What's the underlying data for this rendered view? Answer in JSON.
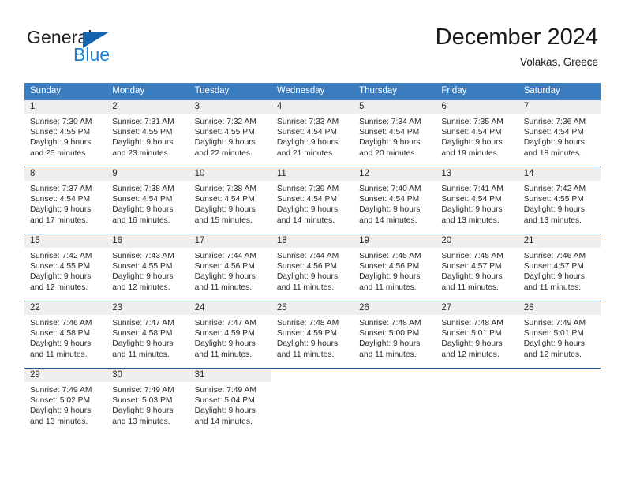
{
  "brand": {
    "name_part1": "General",
    "name_part2": "Blue",
    "triangle_color": "#1565ae",
    "blue_color": "#1b7fd4"
  },
  "header": {
    "title": "December 2024",
    "subtitle": "Volakas, Greece"
  },
  "theme": {
    "header_bg": "#3a7cc0",
    "row_divider": "#1a5fa0",
    "daynum_bg": "#efefef",
    "text": "#2b2b2b"
  },
  "calendar": {
    "weekday_headers": [
      "Sunday",
      "Monday",
      "Tuesday",
      "Wednesday",
      "Thursday",
      "Friday",
      "Saturday"
    ],
    "weeks": [
      [
        {
          "day": "1",
          "sunrise": "Sunrise: 7:30 AM",
          "sunset": "Sunset: 4:55 PM",
          "daylight1": "Daylight: 9 hours",
          "daylight2": "and 25 minutes."
        },
        {
          "day": "2",
          "sunrise": "Sunrise: 7:31 AM",
          "sunset": "Sunset: 4:55 PM",
          "daylight1": "Daylight: 9 hours",
          "daylight2": "and 23 minutes."
        },
        {
          "day": "3",
          "sunrise": "Sunrise: 7:32 AM",
          "sunset": "Sunset: 4:55 PM",
          "daylight1": "Daylight: 9 hours",
          "daylight2": "and 22 minutes."
        },
        {
          "day": "4",
          "sunrise": "Sunrise: 7:33 AM",
          "sunset": "Sunset: 4:54 PM",
          "daylight1": "Daylight: 9 hours",
          "daylight2": "and 21 minutes."
        },
        {
          "day": "5",
          "sunrise": "Sunrise: 7:34 AM",
          "sunset": "Sunset: 4:54 PM",
          "daylight1": "Daylight: 9 hours",
          "daylight2": "and 20 minutes."
        },
        {
          "day": "6",
          "sunrise": "Sunrise: 7:35 AM",
          "sunset": "Sunset: 4:54 PM",
          "daylight1": "Daylight: 9 hours",
          "daylight2": "and 19 minutes."
        },
        {
          "day": "7",
          "sunrise": "Sunrise: 7:36 AM",
          "sunset": "Sunset: 4:54 PM",
          "daylight1": "Daylight: 9 hours",
          "daylight2": "and 18 minutes."
        }
      ],
      [
        {
          "day": "8",
          "sunrise": "Sunrise: 7:37 AM",
          "sunset": "Sunset: 4:54 PM",
          "daylight1": "Daylight: 9 hours",
          "daylight2": "and 17 minutes."
        },
        {
          "day": "9",
          "sunrise": "Sunrise: 7:38 AM",
          "sunset": "Sunset: 4:54 PM",
          "daylight1": "Daylight: 9 hours",
          "daylight2": "and 16 minutes."
        },
        {
          "day": "10",
          "sunrise": "Sunrise: 7:38 AM",
          "sunset": "Sunset: 4:54 PM",
          "daylight1": "Daylight: 9 hours",
          "daylight2": "and 15 minutes."
        },
        {
          "day": "11",
          "sunrise": "Sunrise: 7:39 AM",
          "sunset": "Sunset: 4:54 PM",
          "daylight1": "Daylight: 9 hours",
          "daylight2": "and 14 minutes."
        },
        {
          "day": "12",
          "sunrise": "Sunrise: 7:40 AM",
          "sunset": "Sunset: 4:54 PM",
          "daylight1": "Daylight: 9 hours",
          "daylight2": "and 14 minutes."
        },
        {
          "day": "13",
          "sunrise": "Sunrise: 7:41 AM",
          "sunset": "Sunset: 4:54 PM",
          "daylight1": "Daylight: 9 hours",
          "daylight2": "and 13 minutes."
        },
        {
          "day": "14",
          "sunrise": "Sunrise: 7:42 AM",
          "sunset": "Sunset: 4:55 PM",
          "daylight1": "Daylight: 9 hours",
          "daylight2": "and 13 minutes."
        }
      ],
      [
        {
          "day": "15",
          "sunrise": "Sunrise: 7:42 AM",
          "sunset": "Sunset: 4:55 PM",
          "daylight1": "Daylight: 9 hours",
          "daylight2": "and 12 minutes."
        },
        {
          "day": "16",
          "sunrise": "Sunrise: 7:43 AM",
          "sunset": "Sunset: 4:55 PM",
          "daylight1": "Daylight: 9 hours",
          "daylight2": "and 12 minutes."
        },
        {
          "day": "17",
          "sunrise": "Sunrise: 7:44 AM",
          "sunset": "Sunset: 4:56 PM",
          "daylight1": "Daylight: 9 hours",
          "daylight2": "and 11 minutes."
        },
        {
          "day": "18",
          "sunrise": "Sunrise: 7:44 AM",
          "sunset": "Sunset: 4:56 PM",
          "daylight1": "Daylight: 9 hours",
          "daylight2": "and 11 minutes."
        },
        {
          "day": "19",
          "sunrise": "Sunrise: 7:45 AM",
          "sunset": "Sunset: 4:56 PM",
          "daylight1": "Daylight: 9 hours",
          "daylight2": "and 11 minutes."
        },
        {
          "day": "20",
          "sunrise": "Sunrise: 7:45 AM",
          "sunset": "Sunset: 4:57 PM",
          "daylight1": "Daylight: 9 hours",
          "daylight2": "and 11 minutes."
        },
        {
          "day": "21",
          "sunrise": "Sunrise: 7:46 AM",
          "sunset": "Sunset: 4:57 PM",
          "daylight1": "Daylight: 9 hours",
          "daylight2": "and 11 minutes."
        }
      ],
      [
        {
          "day": "22",
          "sunrise": "Sunrise: 7:46 AM",
          "sunset": "Sunset: 4:58 PM",
          "daylight1": "Daylight: 9 hours",
          "daylight2": "and 11 minutes."
        },
        {
          "day": "23",
          "sunrise": "Sunrise: 7:47 AM",
          "sunset": "Sunset: 4:58 PM",
          "daylight1": "Daylight: 9 hours",
          "daylight2": "and 11 minutes."
        },
        {
          "day": "24",
          "sunrise": "Sunrise: 7:47 AM",
          "sunset": "Sunset: 4:59 PM",
          "daylight1": "Daylight: 9 hours",
          "daylight2": "and 11 minutes."
        },
        {
          "day": "25",
          "sunrise": "Sunrise: 7:48 AM",
          "sunset": "Sunset: 4:59 PM",
          "daylight1": "Daylight: 9 hours",
          "daylight2": "and 11 minutes."
        },
        {
          "day": "26",
          "sunrise": "Sunrise: 7:48 AM",
          "sunset": "Sunset: 5:00 PM",
          "daylight1": "Daylight: 9 hours",
          "daylight2": "and 11 minutes."
        },
        {
          "day": "27",
          "sunrise": "Sunrise: 7:48 AM",
          "sunset": "Sunset: 5:01 PM",
          "daylight1": "Daylight: 9 hours",
          "daylight2": "and 12 minutes."
        },
        {
          "day": "28",
          "sunrise": "Sunrise: 7:49 AM",
          "sunset": "Sunset: 5:01 PM",
          "daylight1": "Daylight: 9 hours",
          "daylight2": "and 12 minutes."
        }
      ],
      [
        {
          "day": "29",
          "sunrise": "Sunrise: 7:49 AM",
          "sunset": "Sunset: 5:02 PM",
          "daylight1": "Daylight: 9 hours",
          "daylight2": "and 13 minutes."
        },
        {
          "day": "30",
          "sunrise": "Sunrise: 7:49 AM",
          "sunset": "Sunset: 5:03 PM",
          "daylight1": "Daylight: 9 hours",
          "daylight2": "and 13 minutes."
        },
        {
          "day": "31",
          "sunrise": "Sunrise: 7:49 AM",
          "sunset": "Sunset: 5:04 PM",
          "daylight1": "Daylight: 9 hours",
          "daylight2": "and 14 minutes."
        },
        {
          "day": "",
          "sunrise": "",
          "sunset": "",
          "daylight1": "",
          "daylight2": ""
        },
        {
          "day": "",
          "sunrise": "",
          "sunset": "",
          "daylight1": "",
          "daylight2": ""
        },
        {
          "day": "",
          "sunrise": "",
          "sunset": "",
          "daylight1": "",
          "daylight2": ""
        },
        {
          "day": "",
          "sunrise": "",
          "sunset": "",
          "daylight1": "",
          "daylight2": ""
        }
      ]
    ]
  }
}
